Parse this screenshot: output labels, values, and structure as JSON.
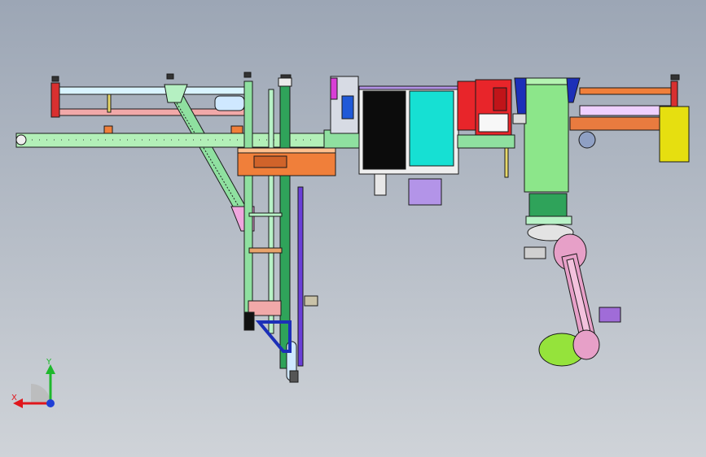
{
  "viewport": {
    "background_top": "#9ca6b5",
    "background_bottom": "#cfd3d8"
  },
  "triad": {
    "x_label": "X",
    "y_label": "Y",
    "x_color": "#e0161c",
    "y_color": "#1eb82c",
    "z_color": "#1f3fd6"
  },
  "palette": {
    "frame_green": "#8fe0a0",
    "rail_green": "#2fa35a",
    "steel_pink": "#f1a9a9",
    "beam_cyan": "#d9f4ff",
    "housing_orange": "#f07f3a",
    "cabinet_red": "#e8252a",
    "screen_cyan": "#16e0d3",
    "panel_black": "#0c0c0c",
    "box_yellow": "#e6df10",
    "tower_green": "#8ce68a",
    "wall_blue": "#1c2fb8",
    "robot_pink": "#e7a0c8",
    "robot_lime": "#95e33b",
    "lilac_box": "#b394e8"
  }
}
